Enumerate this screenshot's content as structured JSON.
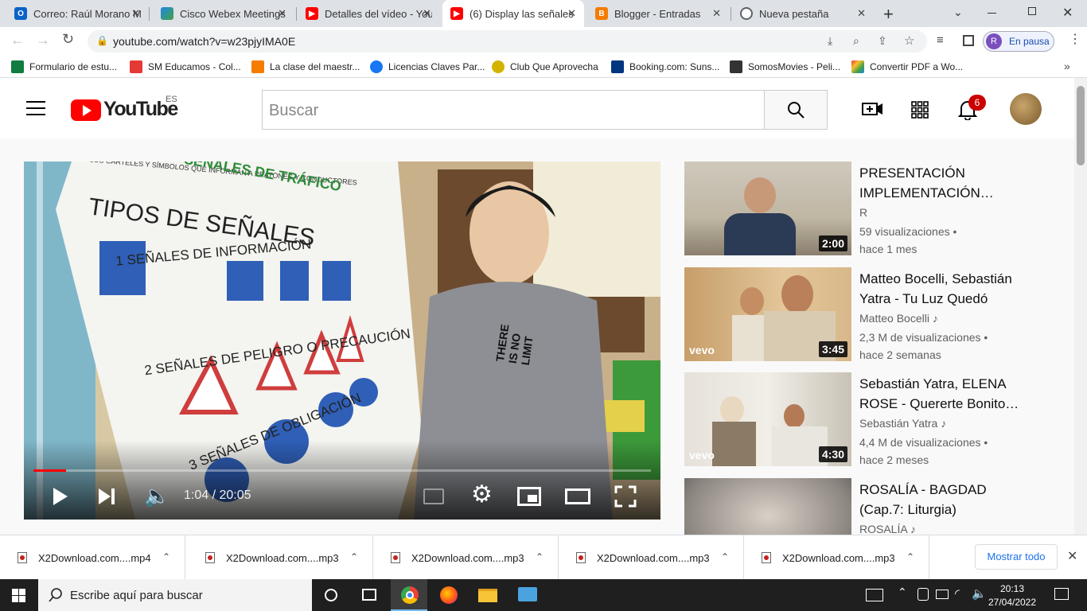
{
  "tabs": [
    {
      "label": "Correo: Raúl Morano M",
      "icon": "outlook-icon",
      "color": "#0a64c8"
    },
    {
      "label": "Cisco Webex Meetings",
      "icon": "webex-icon",
      "color": "#1e88e5"
    },
    {
      "label": "Detalles del vídeo - YouTube",
      "icon": "youtube-icon",
      "color": "#ff0000"
    },
    {
      "label": "(6) Display las señales",
      "icon": "youtube-icon",
      "color": "#ff0000"
    },
    {
      "label": "Blogger - Entradas",
      "icon": "blogger-icon",
      "color": "#f57c00"
    },
    {
      "label": "Nueva pestaña",
      "icon": "chrome-icon",
      "color": "#5f6368"
    }
  ],
  "address": {
    "url": "youtube.com/watch?v=w23pjyIMA0E"
  },
  "profile": {
    "initial": "R",
    "status": "En pausa"
  },
  "bookmarks": [
    {
      "label": "Formulario de estu...",
      "color": "#107c41"
    },
    {
      "label": "SM Educamos - Col...",
      "color": "#e53935"
    },
    {
      "label": "La clase del maestr...",
      "color": "#f57c00"
    },
    {
      "label": "Licencias Claves Par...",
      "color": "#1877f2"
    },
    {
      "label": "Club Que Aprovecha",
      "color": "#d4b200"
    },
    {
      "label": "Booking.com: Suns...",
      "color": "#003580"
    },
    {
      "label": "SomosMovies - Peli...",
      "color": "#333333"
    },
    {
      "label": "Convertir PDF a Wo...",
      "color": "#7e57c2"
    }
  ],
  "youtube": {
    "logo_text": "YouTube",
    "region": "ES",
    "search_placeholder": "Buscar",
    "notifications": "6"
  },
  "player": {
    "time": "1:04 / 20:05",
    "progress": 0.053,
    "poster_title": "TIPOS DE SEÑALES",
    "poster_line0": "SON LOS CARTELES Y SÍMBOLOS QUE INFORMAN A PEATONES Y CONDUCTORES",
    "poster_header": "SEÑALES DE TRÁFICO",
    "poster_items": [
      "1 SEÑALES DE INFORMACIÓN",
      "2 SEÑALES DE PELIGRO O PRECAUCIÓN",
      "3 SEÑALES DE OBLIGACIÓN"
    ],
    "shirt": "THERE IS NO LIMIT"
  },
  "recommendations": [
    {
      "title": "PRESENTACIÓN IMPLEMENTACIÓN…",
      "channel": "R",
      "views": "59 visualizaciones",
      "ago": "hace 1 mes",
      "duration": "2:00",
      "music": false,
      "vevo": false
    },
    {
      "title": "Matteo Bocelli, Sebastián Yatra - Tu Luz Quedó",
      "channel": "Matteo Bocelli",
      "views": "2,3 M de visualizaciones",
      "ago": "hace 2 semanas",
      "duration": "3:45",
      "music": true,
      "vevo": true
    },
    {
      "title": "Sebastián Yatra, ELENA ROSE - Quererte Bonito…",
      "channel": "Sebastián Yatra",
      "views": "4,4 M de visualizaciones",
      "ago": "hace 2 meses",
      "duration": "4:30",
      "music": true,
      "vevo": true
    },
    {
      "title": "ROSALÍA - BAGDAD (Cap.7: Liturgia)",
      "channel": "ROSALÍA",
      "views": "",
      "ago": "",
      "duration": "",
      "music": true,
      "vevo": false
    }
  ],
  "vevo_label": "vevo",
  "downloads": [
    {
      "label": "X2Download.com....mp4"
    },
    {
      "label": "X2Download.com....mp3"
    },
    {
      "label": "X2Download.com....mp3"
    },
    {
      "label": "X2Download.com....mp3"
    },
    {
      "label": "X2Download.com....mp3"
    }
  ],
  "show_all": "Mostrar todo",
  "taskbar": {
    "search": "Escribe aquí para buscar",
    "time": "20:13",
    "date": "27/04/2022"
  }
}
